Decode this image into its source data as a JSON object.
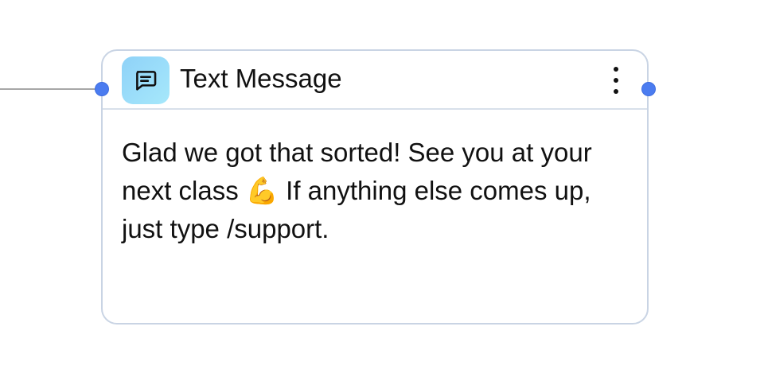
{
  "node": {
    "title": "Text Message",
    "icon": "message-square-text-icon",
    "body_text": "Glad we got that sorted! See you at your next class 💪 If anything else comes up, just type /support."
  },
  "colors": {
    "port": "#4b7cf0",
    "card_border": "#c9d4e4",
    "icon_background": "#9fe3fb",
    "connector": "#a7a7a7"
  }
}
